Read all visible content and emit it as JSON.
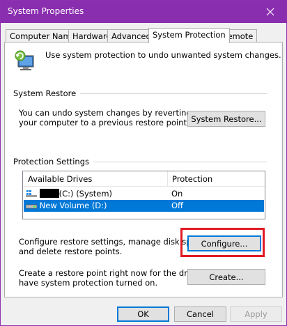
{
  "window": {
    "title": "System Properties"
  },
  "tabs": [
    {
      "label": "Computer Name"
    },
    {
      "label": "Hardware"
    },
    {
      "label": "Advanced"
    },
    {
      "label": "System Protection"
    },
    {
      "label": "Remote"
    }
  ],
  "intro": {
    "text": "Use system protection to undo unwanted system changes."
  },
  "system_restore": {
    "title": "System Restore",
    "description_line1": "You can undo system changes by reverting",
    "description_line2": "your computer to a previous restore point.",
    "button": "System Restore..."
  },
  "protection": {
    "title": "Protection Settings",
    "columns": [
      "Available Drives",
      "Protection"
    ],
    "drives": [
      {
        "name": "(C:) (System)",
        "protection": "On"
      },
      {
        "name": "New Volume (D:)",
        "protection": "Off"
      }
    ],
    "configure_line1": "Configure restore settings, manage disk space,",
    "configure_line2": "and delete restore points.",
    "configure_button": "Configure...",
    "create_line1": "Create a restore point right now for the drives that",
    "create_line2": "have system protection turned on.",
    "create_button": "Create..."
  },
  "footer": {
    "ok": "OK",
    "cancel": "Cancel",
    "apply": "Apply"
  },
  "colors": {
    "titlebar": "#8a2eb0",
    "selection": "#0078d7",
    "highlight": "#e01b24"
  }
}
